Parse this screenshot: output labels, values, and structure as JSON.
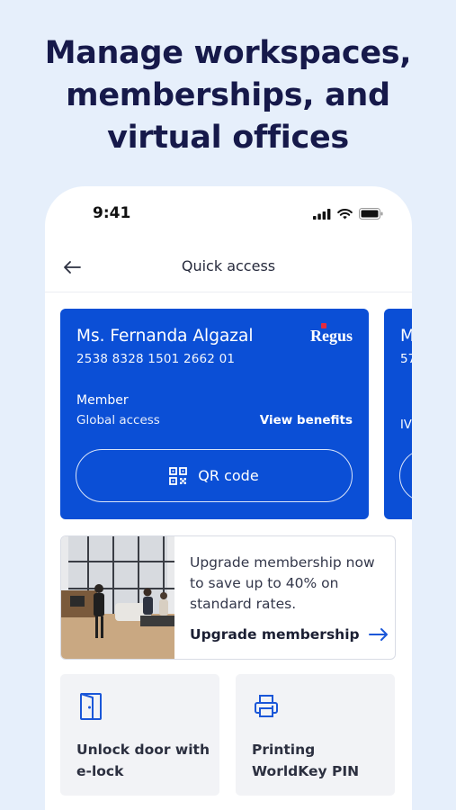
{
  "headline": {
    "line1": "Manage workspaces,",
    "line2": "memberships, and",
    "line3": "virtual offices"
  },
  "status_bar": {
    "time": "9:41"
  },
  "navbar": {
    "title": "Quick access"
  },
  "member_card": {
    "name": "Ms. Fernanda Algazal",
    "number": "2538 8328 1501 2662 01",
    "brand": "Regus",
    "membership_label": "Member",
    "access_label": "Global access",
    "benefits_link": "View benefits",
    "qr_button_label": "QR code"
  },
  "next_card_peek": {
    "letter": "M",
    "digits": "57",
    "label": "IV"
  },
  "upgrade": {
    "text": "Upgrade membership now to save up to 40% on standard rates.",
    "link_label": "Upgrade membership"
  },
  "tiles": [
    {
      "label": "Unlock door with e-lock",
      "icon": "door-icon"
    },
    {
      "label": "Printing WorldKey PIN",
      "icon": "printer-icon"
    }
  ],
  "colors": {
    "background": "#e6effb",
    "card_blue": "#0b4fd6",
    "accent_blue": "#1a56d8",
    "brand_red": "#e32b3e"
  }
}
